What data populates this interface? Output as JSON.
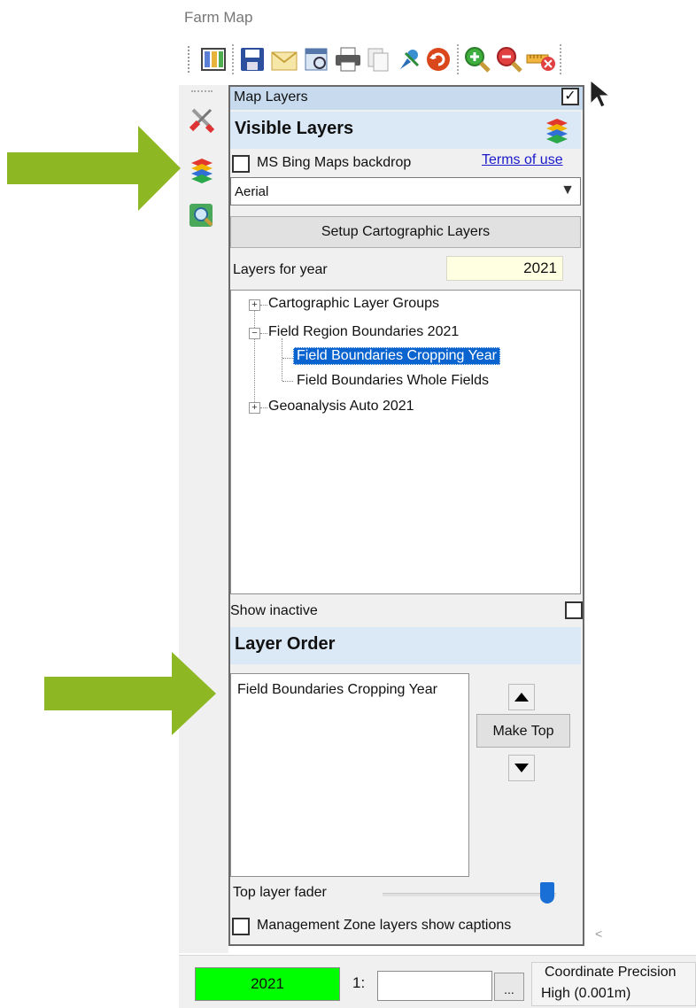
{
  "app": {
    "title": "Farm Map"
  },
  "toolbar": {
    "buttons": [
      {
        "icon": "layout-icon"
      },
      {
        "icon": "save-icon"
      },
      {
        "icon": "email-icon"
      },
      {
        "icon": "report-icon"
      },
      {
        "icon": "print-icon"
      },
      {
        "icon": "copy-icon"
      },
      {
        "icon": "pin-tool-icon"
      },
      {
        "icon": "undo-icon"
      },
      {
        "icon": "zoom-in-icon"
      },
      {
        "icon": "zoom-out-icon"
      },
      {
        "icon": "measure-clear-icon"
      },
      {
        "icon": "pointer-icon"
      }
    ]
  },
  "sidebar": {
    "items": [
      {
        "icon": "tools-icon"
      },
      {
        "icon": "layers-icon"
      },
      {
        "icon": "map-search-icon"
      }
    ]
  },
  "panel": {
    "title": "Map Layers",
    "pin_checked": true,
    "visible_layers_header": "Visible Layers",
    "bing_label": "MS Bing Maps backdrop",
    "bing_checked": false,
    "terms_link": "Terms of use",
    "backdrop_select": "Aerial",
    "setup_button": "Setup Cartographic Layers",
    "year_label": "Layers for year",
    "year_value": "2021",
    "tree": [
      {
        "label": "Cartographic Layer Groups",
        "expander": "+"
      },
      {
        "label": "Field Region Boundaries 2021",
        "expander": "−"
      },
      {
        "label": "Field Boundaries Cropping Year",
        "selected": true
      },
      {
        "label": "Field Boundaries Whole Fields"
      },
      {
        "label": "Geoanalysis Auto 2021",
        "expander": "+"
      }
    ],
    "show_inactive_label": "Show inactive",
    "show_inactive_checked": false,
    "layer_order_header": "Layer Order",
    "layer_order_items": [
      "Field Boundaries Cropping Year"
    ],
    "make_top_button": "Make Top",
    "fader_label": "Top layer fader",
    "fader_value": 1.0,
    "captions_label": "Management Zone layers show captions",
    "captions_checked": false
  },
  "status": {
    "year": "2021",
    "scale_prefix": "1:",
    "scale_value": "",
    "ellipsis": "...",
    "coord_label": "Coordinate Precision",
    "coord_value": "High (0.001m)",
    "year_color": "#00ff00"
  },
  "annotations": {
    "arrow_color": "#8db823"
  }
}
